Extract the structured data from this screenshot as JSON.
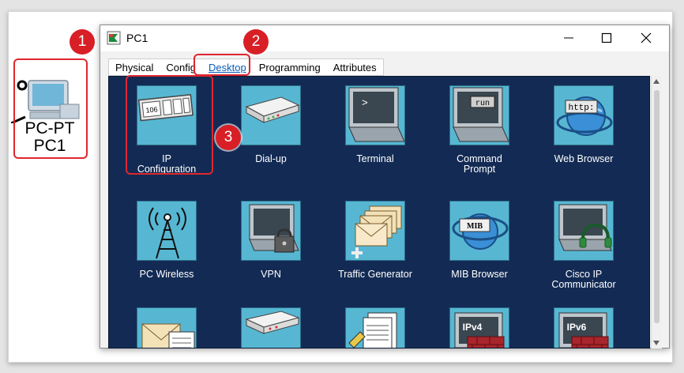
{
  "device": {
    "line1": "PC-PT",
    "line2": "PC1"
  },
  "badges": [
    "1",
    "2",
    "3"
  ],
  "window": {
    "title": "PC1",
    "buttons": {
      "minimize": "minimize-icon",
      "maximize": "maximize-icon",
      "close": "close-icon"
    }
  },
  "tabs": [
    {
      "label": "Physical"
    },
    {
      "label": "Config"
    },
    {
      "label": "Desktop",
      "active": true
    },
    {
      "label": "Programming"
    },
    {
      "label": "Attributes"
    }
  ],
  "apps": [
    {
      "line1": "IP",
      "line2": "Configuration",
      "icon": "ip-configuration-icon",
      "icon_text": "106"
    },
    {
      "line1": "Dial-up",
      "line2": "",
      "icon": "modem-icon",
      "icon_text": ""
    },
    {
      "line1": "Terminal",
      "line2": "",
      "icon": "terminal-icon",
      "icon_text": ">"
    },
    {
      "line1": "Command",
      "line2": "Prompt",
      "icon": "command-prompt-icon",
      "icon_text": "run"
    },
    {
      "line1": "Web Browser",
      "line2": "",
      "icon": "web-browser-icon",
      "icon_text": "http:"
    },
    {
      "line1": "PC Wireless",
      "line2": "",
      "icon": "wireless-icon",
      "icon_text": ""
    },
    {
      "line1": "VPN",
      "line2": "",
      "icon": "vpn-icon",
      "icon_text": ""
    },
    {
      "line1": "Traffic Generator",
      "line2": "",
      "icon": "traffic-generator-icon",
      "icon_text": ""
    },
    {
      "line1": "MIB Browser",
      "line2": "",
      "icon": "mib-browser-icon",
      "icon_text": "MIB"
    },
    {
      "line1": "Cisco IP Communicator",
      "line2": "",
      "icon": "ip-communicator-icon",
      "icon_text": ""
    },
    {
      "line1": "",
      "line2": "",
      "icon": "email-icon",
      "icon_text": ""
    },
    {
      "line1": "",
      "line2": "",
      "icon": "pppoe-dialer-icon",
      "icon_text": ""
    },
    {
      "line1": "",
      "line2": "",
      "icon": "text-editor-icon",
      "icon_text": ""
    },
    {
      "line1": "",
      "line2": "",
      "icon": "ipv4-firewall-icon",
      "icon_text": "IPv4"
    },
    {
      "line1": "",
      "line2": "",
      "icon": "ipv6-firewall-icon",
      "icon_text": "IPv6"
    }
  ],
  "colors": {
    "desktop_bg": "#132b54",
    "tile": "#57b7d3",
    "annotation": "#d81f26"
  }
}
